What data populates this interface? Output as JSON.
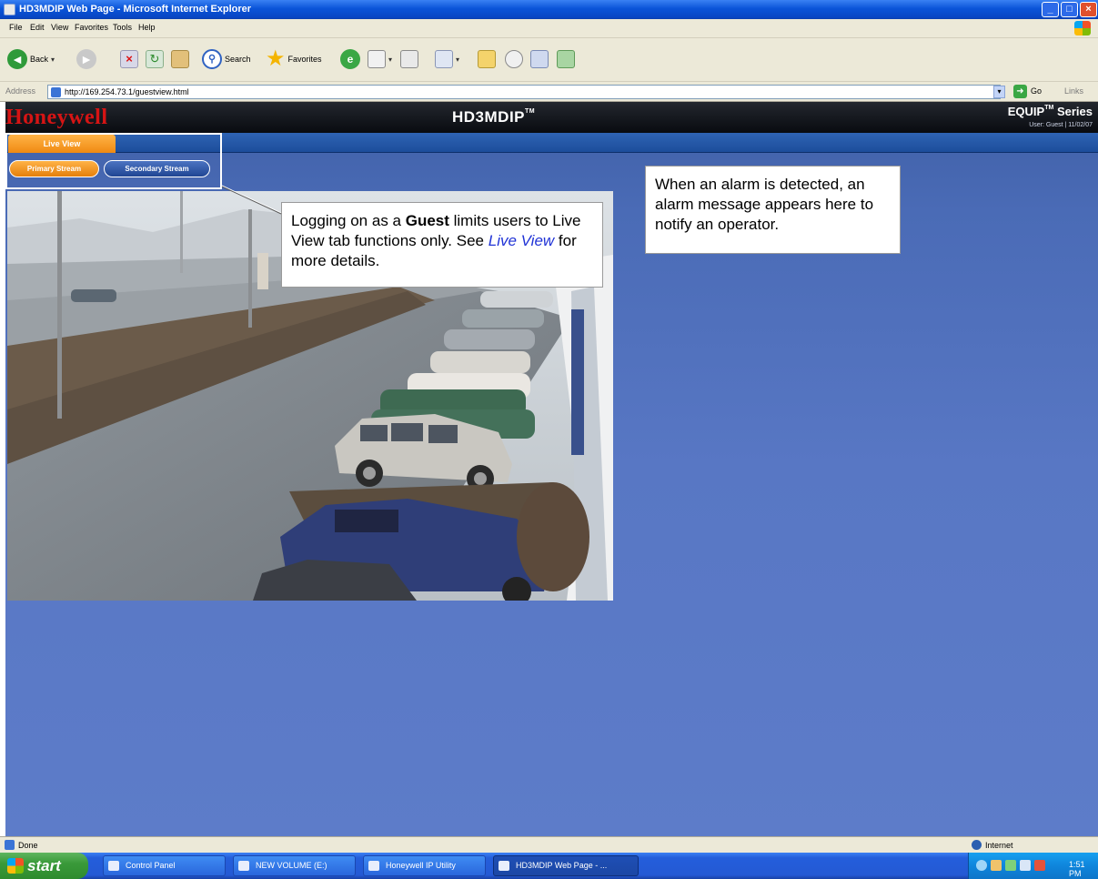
{
  "window": {
    "title": "HD3MDIP Web Page - Microsoft Internet Explorer",
    "min_glyph": "_",
    "max_glyph": "□",
    "close_glyph": "×"
  },
  "menu": [
    "File",
    "Edit",
    "View",
    "Favorites",
    "Tools",
    "Help"
  ],
  "toolbar": {
    "back_label": "Back",
    "search_label": "Search",
    "favorites_label": "Favorites"
  },
  "address": {
    "label": "Address",
    "url": "http://169.254.73.1/guestview.html",
    "go_label": "Go",
    "links_label": "Links"
  },
  "page": {
    "logo": "Honeywell",
    "product": "HD3MDIP",
    "product_tm": "TM",
    "series": "EQUIP",
    "series_tm": "TM",
    "series_word": " Series",
    "user_info": "User: Guest | 11/02/07",
    "tab_live_view": "Live View",
    "btn_primary_stream": "Primary Stream",
    "btn_secondary_stream": "Secondary Stream"
  },
  "callouts": {
    "guest_part1": "Logging on as a ",
    "guest_bold": "Guest",
    "guest_part2": " limits users to Live View tab functions only. See ",
    "guest_link": "Live View",
    "guest_part3": " for more details.",
    "alarm": "When an alarm is detected, an alarm message appears here to notify an operator."
  },
  "status": {
    "left": "Done",
    "zone": "Internet"
  },
  "taskbar": {
    "start": "start",
    "items": [
      "Control Panel",
      "NEW VOLUME (E:)",
      "Honeywell IP Utility",
      "HD3MDIP Web Page - ..."
    ],
    "clock": "1:51 PM"
  }
}
